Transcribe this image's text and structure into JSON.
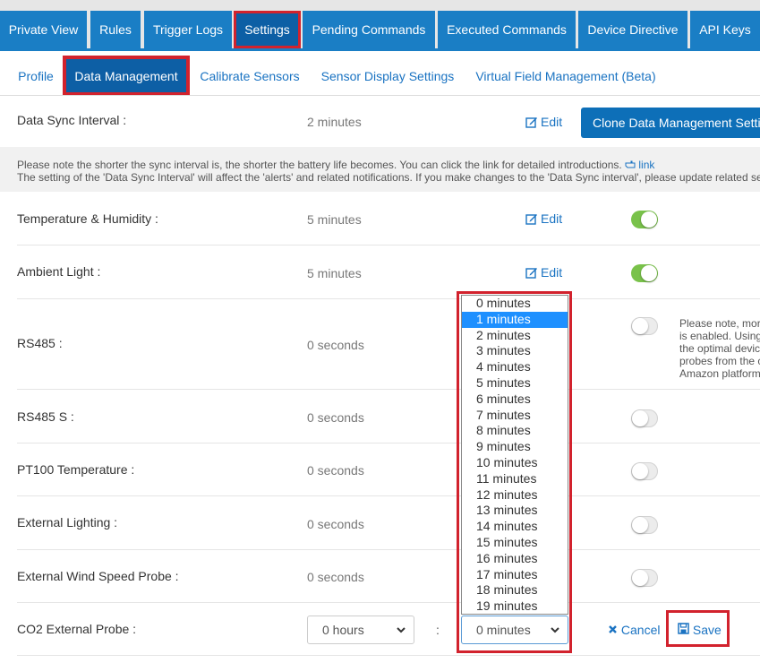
{
  "top_tabs": [
    {
      "label": "Private View"
    },
    {
      "label": "Rules"
    },
    {
      "label": "Trigger Logs"
    },
    {
      "label": "Settings",
      "active": true
    },
    {
      "label": "Pending Commands"
    },
    {
      "label": "Executed Commands"
    },
    {
      "label": "Device Directive"
    },
    {
      "label": "API Keys"
    }
  ],
  "sub_tabs": [
    {
      "label": "Profile"
    },
    {
      "label": "Data Management",
      "active": true
    },
    {
      "label": "Calibrate Sensors"
    },
    {
      "label": "Sensor Display Settings"
    },
    {
      "label": "Virtual Field Management (Beta)"
    }
  ],
  "sync": {
    "label": "Data Sync Interval :",
    "value": "2 minutes",
    "edit_label": "Edit",
    "clone_label": "Clone Data Management Settings"
  },
  "note": {
    "line1": "Please note the shorter the sync interval is, the shorter the battery life becomes. You can click the link for detailed introductions.",
    "link_label": "link",
    "line2": "The setting of the 'Data Sync Interval' will affect the 'alerts' and related notifications. If you make changes to the 'Data Sync interval', please update related settings."
  },
  "sensors": [
    {
      "label": "Temperature & Humidity :",
      "value": "5 minutes",
      "edit_label": "Edit",
      "enabled": true
    },
    {
      "label": "Ambient Light :",
      "value": "5 minutes",
      "edit_label": "Edit",
      "enabled": true
    },
    {
      "label": "RS485 :",
      "value": "0 seconds",
      "enabled": false
    },
    {
      "label": "RS485 S :",
      "value": "0 seconds",
      "enabled": false
    },
    {
      "label": "PT100 Temperature :",
      "value": "0 seconds",
      "enabled": false
    },
    {
      "label": "External Lighting :",
      "value": "0 seconds",
      "enabled": false
    },
    {
      "label": "External Wind Speed Probe :",
      "value": "0 seconds",
      "enabled": false
    }
  ],
  "rs485_note": {
    "lines": [
      "Please note, mor",
      "is enabled. Using",
      "the optimal devic",
      "probes from the c",
      "Amazon platform"
    ]
  },
  "co2": {
    "label": "CO2 External Probe :",
    "hours_value": "0 hours",
    "colon": ":",
    "minutes_value": "0 minutes",
    "cancel_label": "Cancel",
    "save_label": "Save"
  },
  "minute_options": [
    "0 minutes",
    "1 minutes",
    "2 minutes",
    "3 minutes",
    "4 minutes",
    "5 minutes",
    "6 minutes",
    "7 minutes",
    "8 minutes",
    "9 minutes",
    "10 minutes",
    "11 minutes",
    "12 minutes",
    "13 minutes",
    "14 minutes",
    "15 minutes",
    "16 minutes",
    "17 minutes",
    "18 minutes",
    "19 minutes"
  ],
  "highlighted_option": "1 minutes",
  "colors": {
    "primary": "#1a7ec5",
    "active_tab": "#0d5fa5",
    "highlight_border": "#d2222d",
    "toggle_on": "#79c24a",
    "option_selected": "#1e90ff"
  }
}
